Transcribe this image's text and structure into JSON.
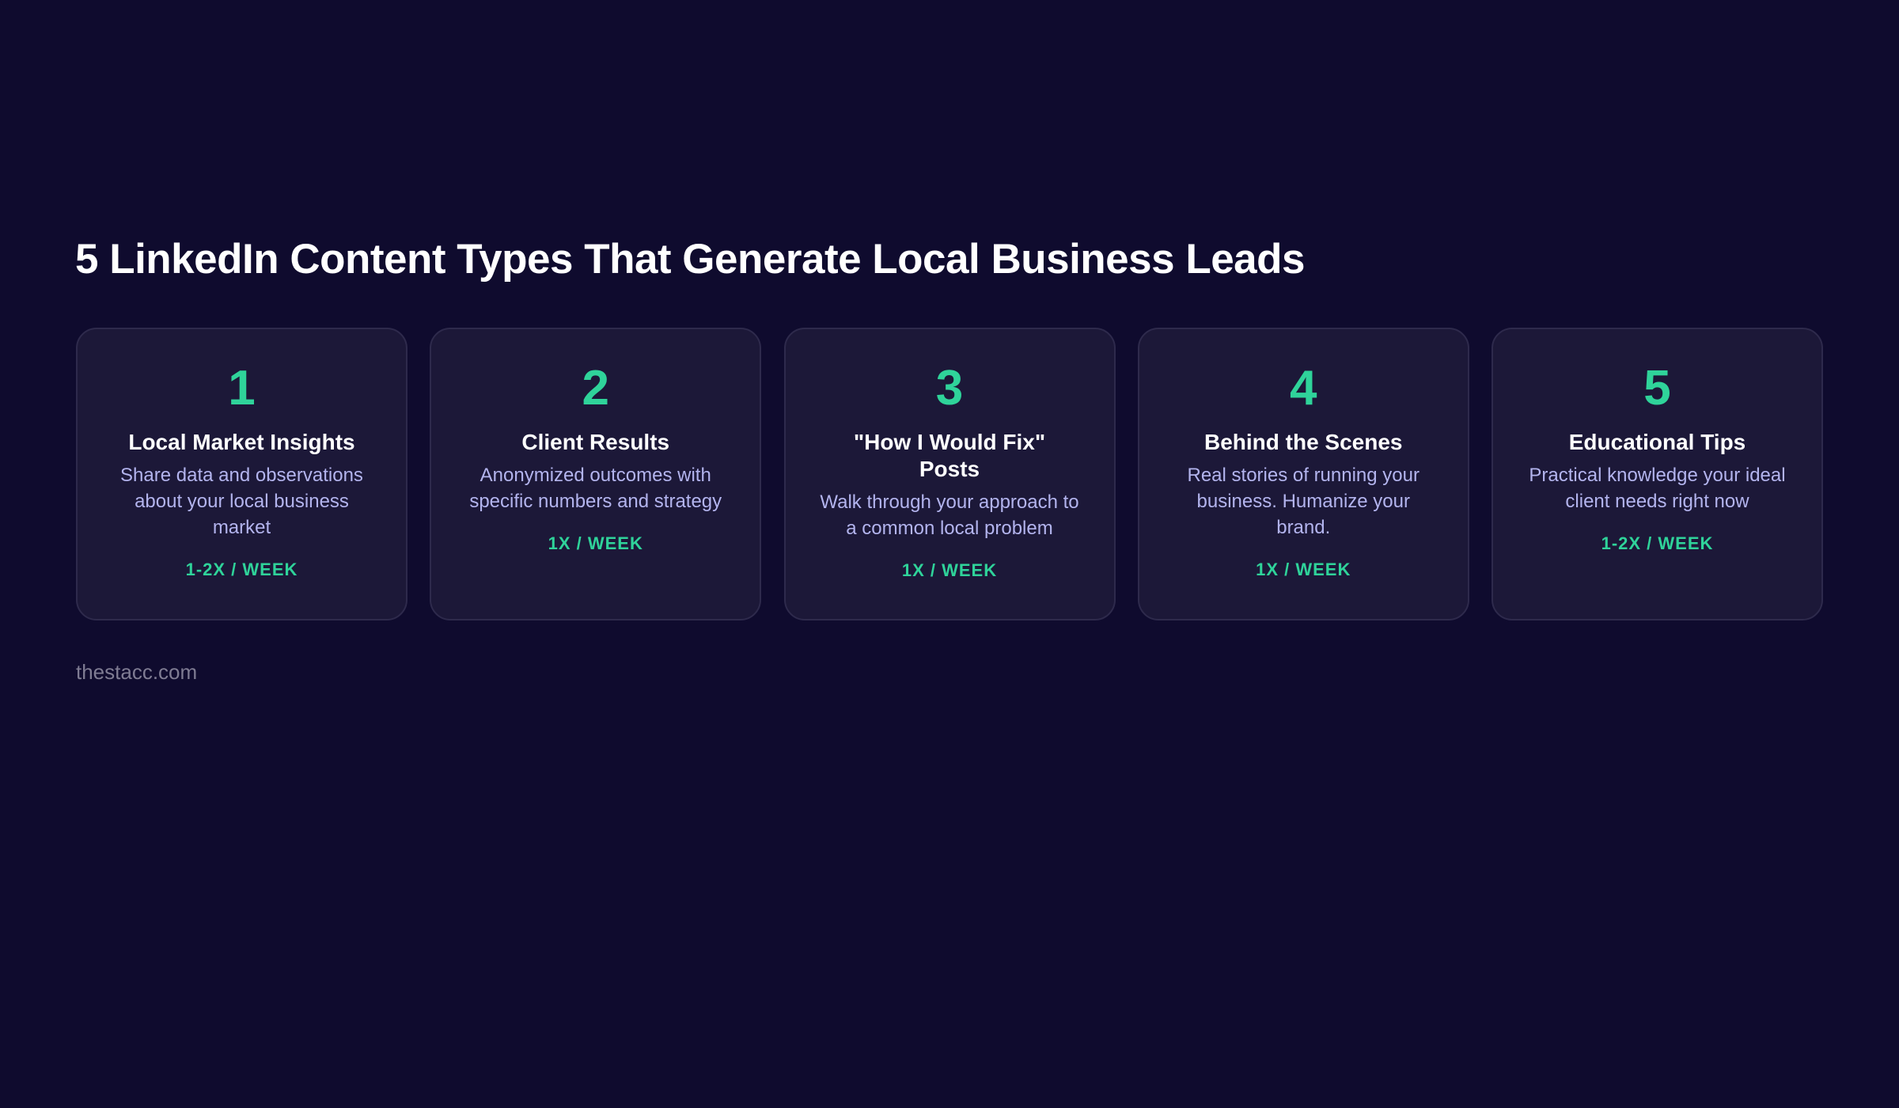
{
  "header": {
    "title": "5 LinkedIn Content Types That Generate Local Business Leads"
  },
  "cards": [
    {
      "number": "1",
      "title": "Local Market Insights",
      "description": "Share data and observations about your local business market",
      "frequency": "1-2X / WEEK"
    },
    {
      "number": "2",
      "title": "Client Results",
      "description": "Anonymized outcomes with specific numbers and strategy",
      "frequency": "1X / WEEK"
    },
    {
      "number": "3",
      "title": "\"How I Would Fix\" Posts",
      "description": "Walk through your approach to a common local problem",
      "frequency": "1X / WEEK"
    },
    {
      "number": "4",
      "title": "Behind the Scenes",
      "description": "Real stories of running your business. Humanize your brand.",
      "frequency": "1X / WEEK"
    },
    {
      "number": "5",
      "title": "Educational Tips",
      "description": "Practical knowledge your ideal client needs right now",
      "frequency": "1-2X / WEEK"
    }
  ],
  "footer": {
    "source": "thestacc.com"
  },
  "colors": {
    "background": "#0f0b2e",
    "card_background": "#1c1838",
    "card_border": "#2e2a4c",
    "accent": "#2fd39a",
    "title_text": "#ffffff",
    "description_text": "#b3b4ee",
    "footer_text": "#7f7c93"
  }
}
